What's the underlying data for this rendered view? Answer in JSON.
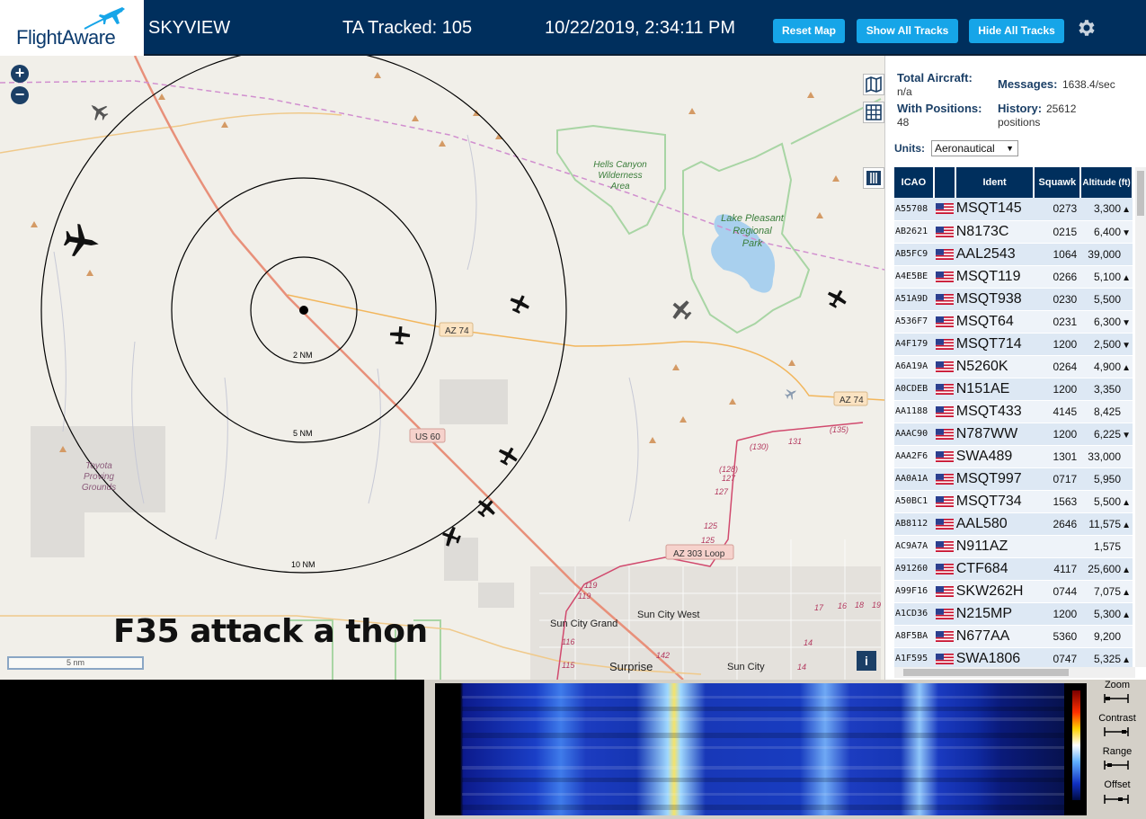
{
  "header": {
    "logo_text": "FlightAware",
    "app_name": "SKYVIEW",
    "tracked": "TA Tracked: 105",
    "datetime": "10/22/2019, 2:34:11 PM",
    "buttons": {
      "reset_map": "Reset Map",
      "show_all": "Show All Tracks",
      "hide_all": "Hide All Tracks"
    },
    "colors": {
      "bar": "#002f5d",
      "button": "#16a5e8"
    }
  },
  "map": {
    "zoom_in": "+",
    "zoom_out": "−",
    "overlay_text": "F35 attack a thon",
    "scale_label": "5 nm",
    "info": "i",
    "ring_labels": [
      "2 NM",
      "5 NM",
      "10 NM"
    ],
    "road_labels": [
      "AZ 74",
      "AZ 74",
      "US 60",
      "AZ 303 Loop"
    ],
    "place_labels": {
      "hells_canyon": [
        "Hells Canyon",
        "Wilderness",
        "Area"
      ],
      "lake_pleasant": [
        "Lake Pleasant",
        "Regional",
        "Park"
      ],
      "toyota": [
        "Toyota",
        "Proving",
        "Grounds"
      ],
      "sun_city_grand": "Sun City Grand",
      "sun_city_west": "Sun City West",
      "surprise": "Surprise",
      "sun_city": "Sun City"
    },
    "route_numbers": [
      "(130)",
      "131",
      "(135)",
      "(128)",
      "127",
      "127",
      "125",
      "125",
      "119",
      "119",
      "116",
      "115",
      "142",
      "17",
      "16",
      "18",
      "19",
      "14",
      "14"
    ]
  },
  "sidebar": {
    "total_aircraft_label": "Total Aircraft:",
    "total_aircraft_value": "n/a",
    "with_positions_label": "With Positions:",
    "with_positions_value": "48",
    "messages_label": "Messages:",
    "messages_value": "1638.4/sec",
    "history_label": "History:",
    "history_value": "25612",
    "history_unit": "positions",
    "units_label": "Units:",
    "units_value": "Aeronautical",
    "columns": [
      "ICAO",
      "",
      "Ident",
      "Squawk",
      "Altitude (ft)"
    ],
    "rows": [
      {
        "icao": "A55708",
        "ident": "MSQT145",
        "squawk": "0273",
        "alt": "3,300",
        "trend": "▲"
      },
      {
        "icao": "AB2621",
        "ident": "N8173C",
        "squawk": "0215",
        "alt": "6,400",
        "trend": "▼"
      },
      {
        "icao": "AB5FC9",
        "ident": "AAL2543",
        "squawk": "1064",
        "alt": "39,000",
        "trend": ""
      },
      {
        "icao": "A4E5BE",
        "ident": "MSQT119",
        "squawk": "0266",
        "alt": "5,100",
        "trend": "▲"
      },
      {
        "icao": "A51A9D",
        "ident": "MSQT938",
        "squawk": "0230",
        "alt": "5,500",
        "trend": ""
      },
      {
        "icao": "A536F7",
        "ident": "MSQT64",
        "squawk": "0231",
        "alt": "6,300",
        "trend": "▼"
      },
      {
        "icao": "A4F179",
        "ident": "MSQT714",
        "squawk": "1200",
        "alt": "2,500",
        "trend": "▼"
      },
      {
        "icao": "A6A19A",
        "ident": "N5260K",
        "squawk": "0264",
        "alt": "4,900",
        "trend": "▲"
      },
      {
        "icao": "A0CDEB",
        "ident": "N151AE",
        "squawk": "1200",
        "alt": "3,350",
        "trend": ""
      },
      {
        "icao": "AA1188",
        "ident": "MSQT433",
        "squawk": "4145",
        "alt": "8,425",
        "trend": ""
      },
      {
        "icao": "AAAC90",
        "ident": "N787WW",
        "squawk": "1200",
        "alt": "6,225",
        "trend": "▼"
      },
      {
        "icao": "AAA2F6",
        "ident": "SWA489",
        "squawk": "1301",
        "alt": "33,000",
        "trend": ""
      },
      {
        "icao": "AA0A1A",
        "ident": "MSQT997",
        "squawk": "0717",
        "alt": "5,950",
        "trend": ""
      },
      {
        "icao": "A50BC1",
        "ident": "MSQT734",
        "squawk": "1563",
        "alt": "5,500",
        "trend": "▲"
      },
      {
        "icao": "AB8112",
        "ident": "AAL580",
        "squawk": "2646",
        "alt": "11,575",
        "trend": "▲"
      },
      {
        "icao": "AC9A7A",
        "ident": "N911AZ",
        "squawk": "",
        "alt": "1,575",
        "trend": ""
      },
      {
        "icao": "A91260",
        "ident": "CTF684",
        "squawk": "4117",
        "alt": "25,600",
        "trend": "▲"
      },
      {
        "icao": "A99F16",
        "ident": "SKW262H",
        "squawk": "0744",
        "alt": "7,075",
        "trend": "▲"
      },
      {
        "icao": "A1CD36",
        "ident": "N215MP",
        "squawk": "1200",
        "alt": "5,300",
        "trend": "▲"
      },
      {
        "icao": "A8F5BA",
        "ident": "N677AA",
        "squawk": "5360",
        "alt": "9,200",
        "trend": ""
      },
      {
        "icao": "A1F595",
        "ident": "SWA1806",
        "squawk": "0747",
        "alt": "5,325",
        "trend": "▲"
      }
    ]
  },
  "waterfall": {
    "labels": [
      "Zoom",
      "Contrast",
      "Range",
      "Offset"
    ]
  }
}
